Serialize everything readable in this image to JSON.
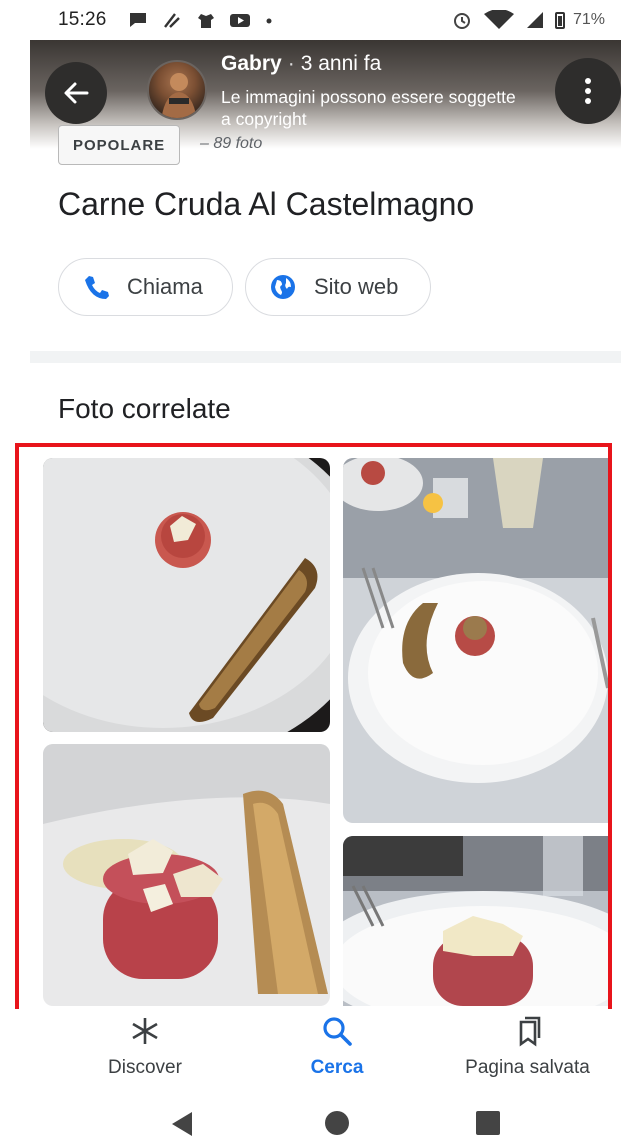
{
  "status_bar": {
    "time": "15:26",
    "battery": "71%"
  },
  "photo_header": {
    "author": "Gabry",
    "separator": "·",
    "time_ago": "3 anni fa",
    "copyright_notice": "Le immagini possono essere soggette a copyright"
  },
  "badge": {
    "label": "POPOLARE",
    "count": "– 89 foto"
  },
  "place": {
    "title": "Carne Cruda Al Castelmagno"
  },
  "actions": {
    "call_label": "Chiama",
    "website_label": "Sito web"
  },
  "related": {
    "title": "Foto correlate"
  },
  "bottom_nav": {
    "items": [
      {
        "label": "Discover",
        "icon": "asterisk-icon",
        "active": false
      },
      {
        "label": "Cerca",
        "icon": "search-icon",
        "active": true
      },
      {
        "label": "Pagina salvata",
        "icon": "bookmark-icon",
        "active": false
      }
    ]
  },
  "colors": {
    "accent": "#1a73e8",
    "highlight": "#e8141b"
  }
}
